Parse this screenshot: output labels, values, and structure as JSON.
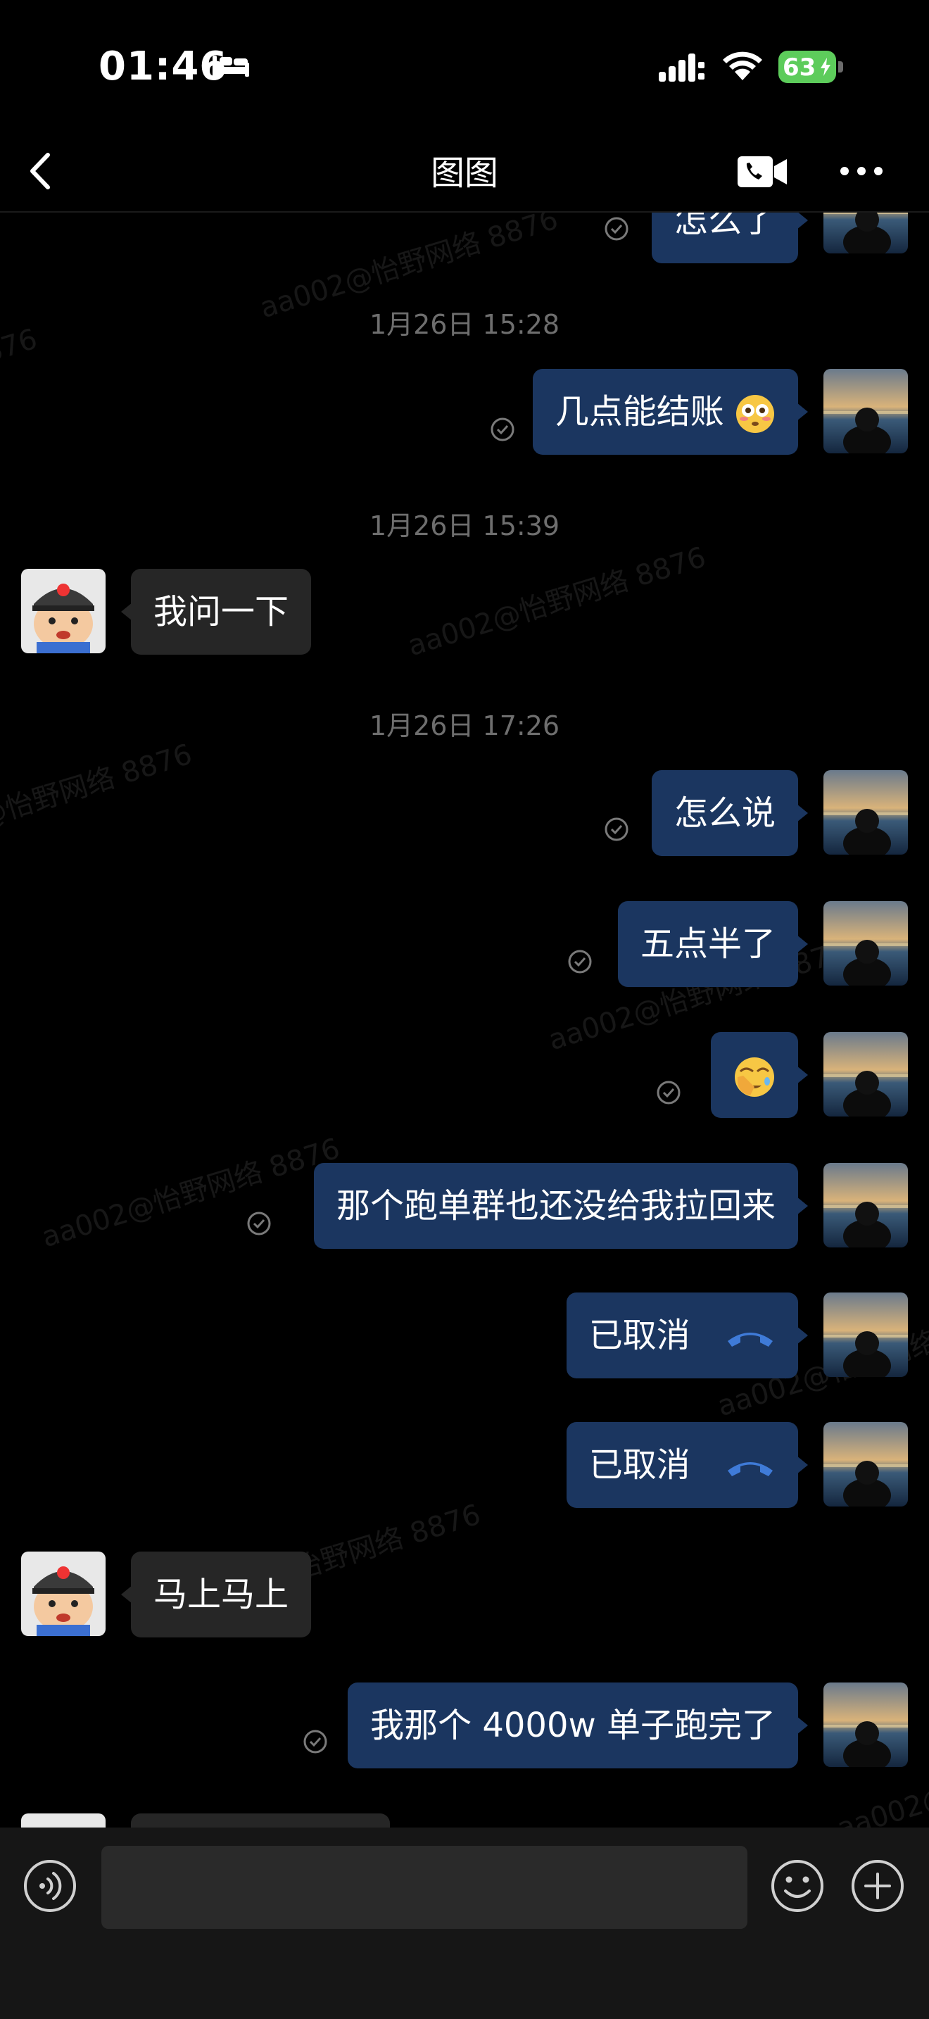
{
  "status_bar": {
    "time": "01:46",
    "battery": "63"
  },
  "header": {
    "title": "图图"
  },
  "messages": [
    {
      "type": "out",
      "text": "怎么了"
    },
    {
      "type": "time",
      "text": "1月26日 15:28"
    },
    {
      "type": "out",
      "text": "几点能结账"
    },
    {
      "type": "time",
      "text": "1月26日 15:39"
    },
    {
      "type": "in",
      "text": "我问一下"
    },
    {
      "type": "time",
      "text": "1月26日 17:26"
    },
    {
      "type": "out",
      "text": "怎么说"
    },
    {
      "type": "out",
      "text": "五点半了"
    },
    {
      "type": "out",
      "emoji": "facepalm-emoji"
    },
    {
      "type": "out",
      "text": "那个跑单群也还没给我拉回来"
    },
    {
      "type": "out",
      "text": "已取消",
      "icon": "phone-hangup-icon"
    },
    {
      "type": "out",
      "text": "已取消",
      "icon": "phone-hangup-icon"
    },
    {
      "type": "in",
      "text": "马上马上"
    },
    {
      "type": "out",
      "text": "我那个 4000w 单子跑完了"
    }
  ],
  "watermark": "aa002@怡野网络 8876",
  "colors": {
    "outgoing_bubble": "#1b3660",
    "incoming_bubble": "#262626",
    "battery": "#5dcc5b",
    "accent": "#3f7bd8"
  },
  "input_bar": {
    "placeholder": ""
  }
}
